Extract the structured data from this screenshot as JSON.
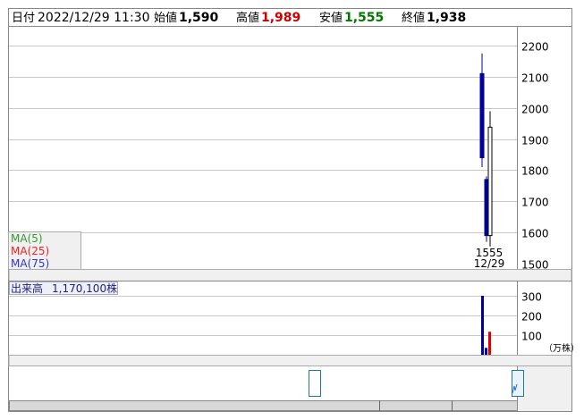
{
  "header": {
    "date_label": "日付",
    "datetime": "2022/12/29 11:30",
    "open_label": "始値",
    "open_value": "1,590",
    "high_label": "高値",
    "high_value": "1,989",
    "low_label": "安値",
    "low_value": "1,555",
    "close_label": "終値",
    "close_value": "1,938"
  },
  "legend": {
    "ma5": "MA(5)",
    "ma25": "MA(25)",
    "ma75": "MA(75)"
  },
  "annotations": {
    "low_marker": "1555",
    "date_marker": "12/29"
  },
  "volume_panel": {
    "label": "出来高",
    "value": "1,170,100株",
    "unit": "（万株）"
  },
  "colors": {
    "up_high": "#cc0000",
    "down_low": "#007700",
    "candle_blue": "#000099",
    "ma5": "#339933",
    "ma25": "#ee2222",
    "ma75": "#3333cc",
    "grid": "#c8c8c8",
    "panel_bg": "#f0f0f0"
  },
  "chart_data": [
    {
      "type": "candlestick",
      "title": "",
      "xlabel": "",
      "ylabel": "",
      "ylim": [
        1480,
        2260
      ],
      "yticks": [
        1500,
        1600,
        1700,
        1800,
        1900,
        2000,
        2100,
        2200
      ],
      "grid": true,
      "candles": [
        {
          "id": "c1",
          "open": 2110,
          "high": 2175,
          "low": 1810,
          "close": 1840,
          "color": "blue"
        },
        {
          "id": "c2",
          "open": 1770,
          "high": 1780,
          "low": 1570,
          "close": 1590,
          "color": "blue"
        },
        {
          "id": "c3",
          "open": 1590,
          "high": 1989,
          "low": 1555,
          "close": 1938,
          "color": "white"
        }
      ]
    },
    {
      "type": "bar",
      "title": "出来高",
      "ylabel": "（万株）",
      "ylim": [
        0,
        330
      ],
      "yticks": [
        100,
        200,
        300
      ],
      "grid": true,
      "bars": [
        {
          "id": "v1",
          "value": 300,
          "color": "blue"
        },
        {
          "id": "v2",
          "value": 35,
          "color": "blue"
        },
        {
          "id": "v3",
          "value": 117,
          "color": "red"
        }
      ]
    }
  ]
}
